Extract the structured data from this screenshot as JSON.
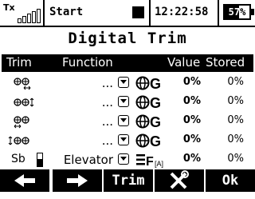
{
  "status": {
    "tx_label": "Tx",
    "signal_bars": 5,
    "title": "Start",
    "clock": "12:22:58",
    "battery_text": "57%",
    "battery_level_percent": 57
  },
  "title": "Digital Trim",
  "table": {
    "headers": {
      "trim": "Trim",
      "function": "Function",
      "value": "Value",
      "stored": "Stored"
    },
    "rows": [
      {
        "trim_icon": "trim-horizontal-icon",
        "function": "...",
        "mode_icon": "global-mode-icon",
        "value": "0%",
        "stored": "0%"
      },
      {
        "trim_icon": "trim-vertical-icon",
        "function": "...",
        "mode_icon": "global-mode-icon",
        "value": "0%",
        "stored": "0%"
      },
      {
        "trim_icon": "trim-horizontal-icon",
        "function": "...",
        "mode_icon": "global-mode-icon",
        "value": "0%",
        "stored": "0%"
      },
      {
        "trim_icon": "trim-vertical-icon",
        "function": "...",
        "mode_icon": "global-mode-icon",
        "value": "0%",
        "stored": "0%"
      },
      {
        "trim_label": "Sb",
        "function": "Elevator",
        "mode_icon": "flight-mode-icon",
        "value": "0%",
        "stored": "0%"
      }
    ]
  },
  "bottom": {
    "keys": [
      {
        "icon": "back-arrow-icon"
      },
      {
        "icon": "forward-arrow-icon"
      },
      {
        "label": "Trim"
      },
      {
        "icon": "tools-icon"
      },
      {
        "label": "Ok"
      }
    ]
  }
}
